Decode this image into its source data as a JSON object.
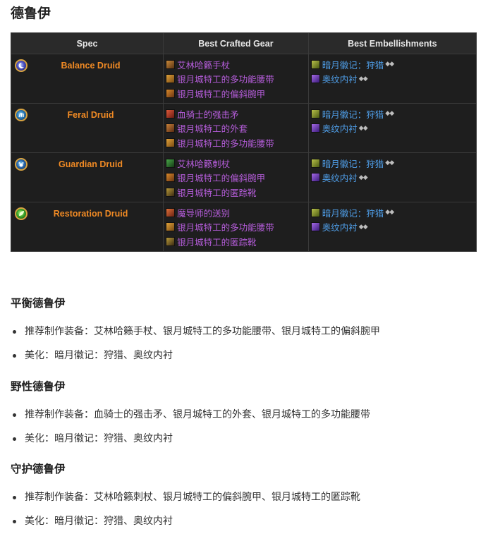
{
  "page": {
    "title": "德鲁伊"
  },
  "table": {
    "headers": {
      "spec": "Spec",
      "gear": "Best Crafted Gear",
      "embellishments": "Best Embellishments"
    },
    "rows": [
      {
        "spec": "Balance Druid",
        "spec_icon": "moon-icon",
        "spec_color": "#f08a24",
        "gear": [
          "艾林哈籁手杖",
          "银月城特工的多功能腰带",
          "银月城特工的偏斜腕甲"
        ],
        "embellishments": [
          "暗月徽记：狩猎",
          "奥纹内衬"
        ]
      },
      {
        "spec": "Feral Druid",
        "spec_icon": "claw-icon",
        "spec_color": "#f08a24",
        "gear": [
          "血骑士的强击矛",
          "银月城特工的外套",
          "银月城特工的多功能腰带"
        ],
        "embellishments": [
          "暗月徽记：狩猎",
          "奥纹内衬"
        ]
      },
      {
        "spec": "Guardian Druid",
        "spec_icon": "bear-icon",
        "spec_color": "#f08a24",
        "gear": [
          "艾林哈籁刺杖",
          "银月城特工的偏斜腕甲",
          "银月城特工的匿踪靴"
        ],
        "embellishments": [
          "暗月徽记：狩猎",
          "奥纹内衬"
        ]
      },
      {
        "spec": "Restoration Druid",
        "spec_icon": "leaf-icon",
        "spec_color": "#f08a24",
        "gear": [
          "魔导师的送别",
          "银月城特工的多功能腰带",
          "银月城特工的匿踪靴"
        ],
        "embellishments": [
          "暗月徽记：狩猎",
          "奥纹内衬"
        ]
      }
    ],
    "gem_glyph": "◆◆"
  },
  "sections": [
    {
      "heading": "平衡德鲁伊",
      "items": [
        "推荐制作装备：艾林哈籁手杖、银月城特工的多功能腰带、银月城特工的偏斜腕甲",
        "美化：暗月徽记：狩猎、奥纹内衬"
      ]
    },
    {
      "heading": "野性德鲁伊",
      "items": [
        "推荐制作装备：血骑士的强击矛、银月城特工的外套、银月城特工的多功能腰带",
        "美化：暗月徽记：狩猎、奥纹内衬"
      ]
    },
    {
      "heading": "守护德鲁伊",
      "items": [
        "推荐制作装备：艾林哈籁刺杖、银月城特工的偏斜腕甲、银月城特工的匿踪靴",
        "美化：暗月徽记：狩猎、奥纹内衬"
      ]
    }
  ],
  "colors": {
    "gear_text": "#b65ddb",
    "embellishment_text": "#4f9ee8",
    "spec_text": "#f08a24",
    "table_bg": "#1e1e1e"
  }
}
